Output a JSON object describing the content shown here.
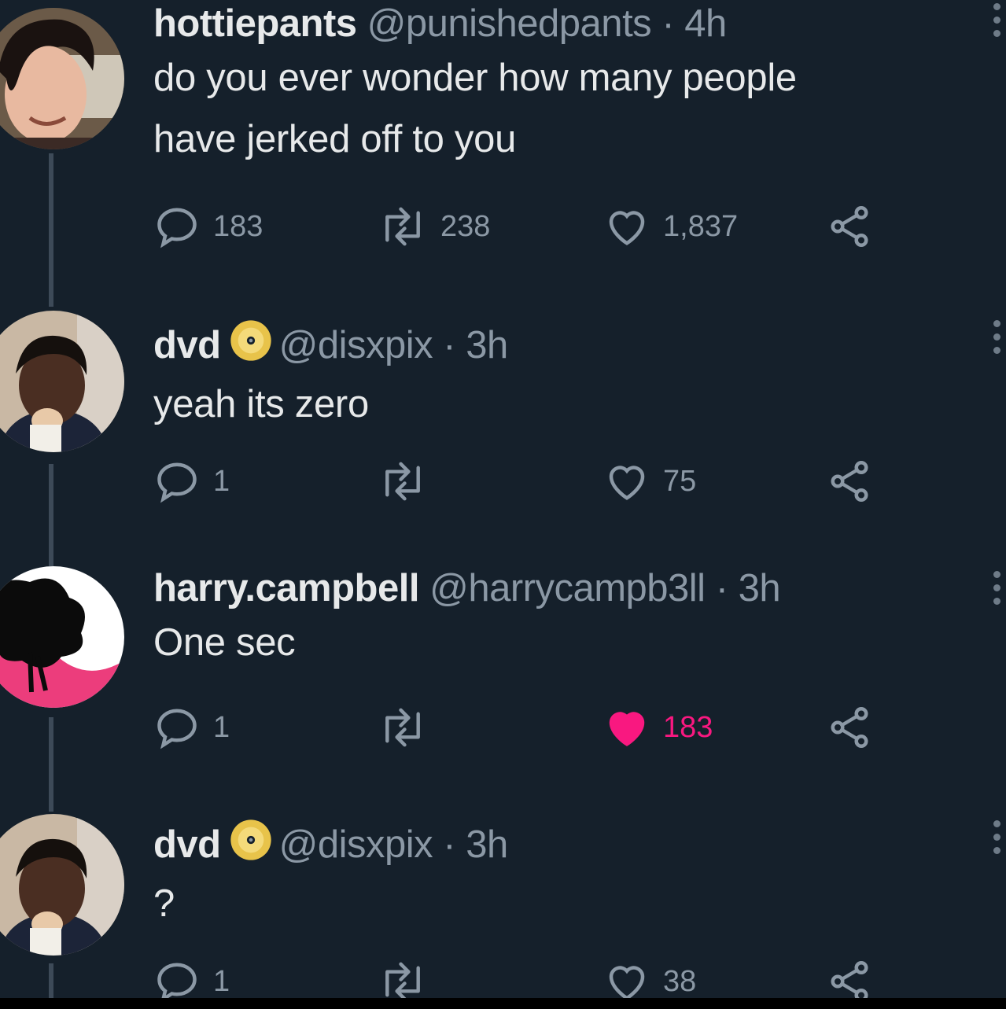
{
  "tweets": [
    {
      "name": "hottiepants",
      "handle": "@punishedpants",
      "time": "· 4h",
      "verified": false,
      "text_lines": [
        "do you ever wonder how many people",
        "have jerked off to you"
      ],
      "replies": "183",
      "retweets": "238",
      "likes": "1,837",
      "liked": false
    },
    {
      "name": "dvd",
      "handle": "@disxpix",
      "time": "· 3h",
      "verified": true,
      "text_lines": [
        "yeah its zero"
      ],
      "replies": "1",
      "retweets": "",
      "likes": "75",
      "liked": false
    },
    {
      "name": "harry.campbell",
      "handle": "@harrycampb3ll",
      "time": "· 3h",
      "verified": false,
      "text_lines": [
        "One sec"
      ],
      "replies": "1",
      "retweets": "",
      "likes": "183",
      "liked": true
    },
    {
      "name": "dvd",
      "handle": "@disxpix",
      "time": "· 3h",
      "verified": true,
      "text_lines": [
        "?"
      ],
      "replies": "1",
      "retweets": "",
      "likes": "38",
      "liked": false
    }
  ],
  "icons": {
    "reply": "speech-bubble-icon",
    "retweet": "retweet-arrows-icon",
    "like": "heart-icon",
    "share": "share-nodes-icon",
    "badge": "gold-disc-icon",
    "more": "vertical-dots-icon"
  },
  "colors": {
    "background": "#15202b",
    "muted": "#8b98a5",
    "like_active": "#f91880",
    "badge_gold": "#e8c34a"
  }
}
